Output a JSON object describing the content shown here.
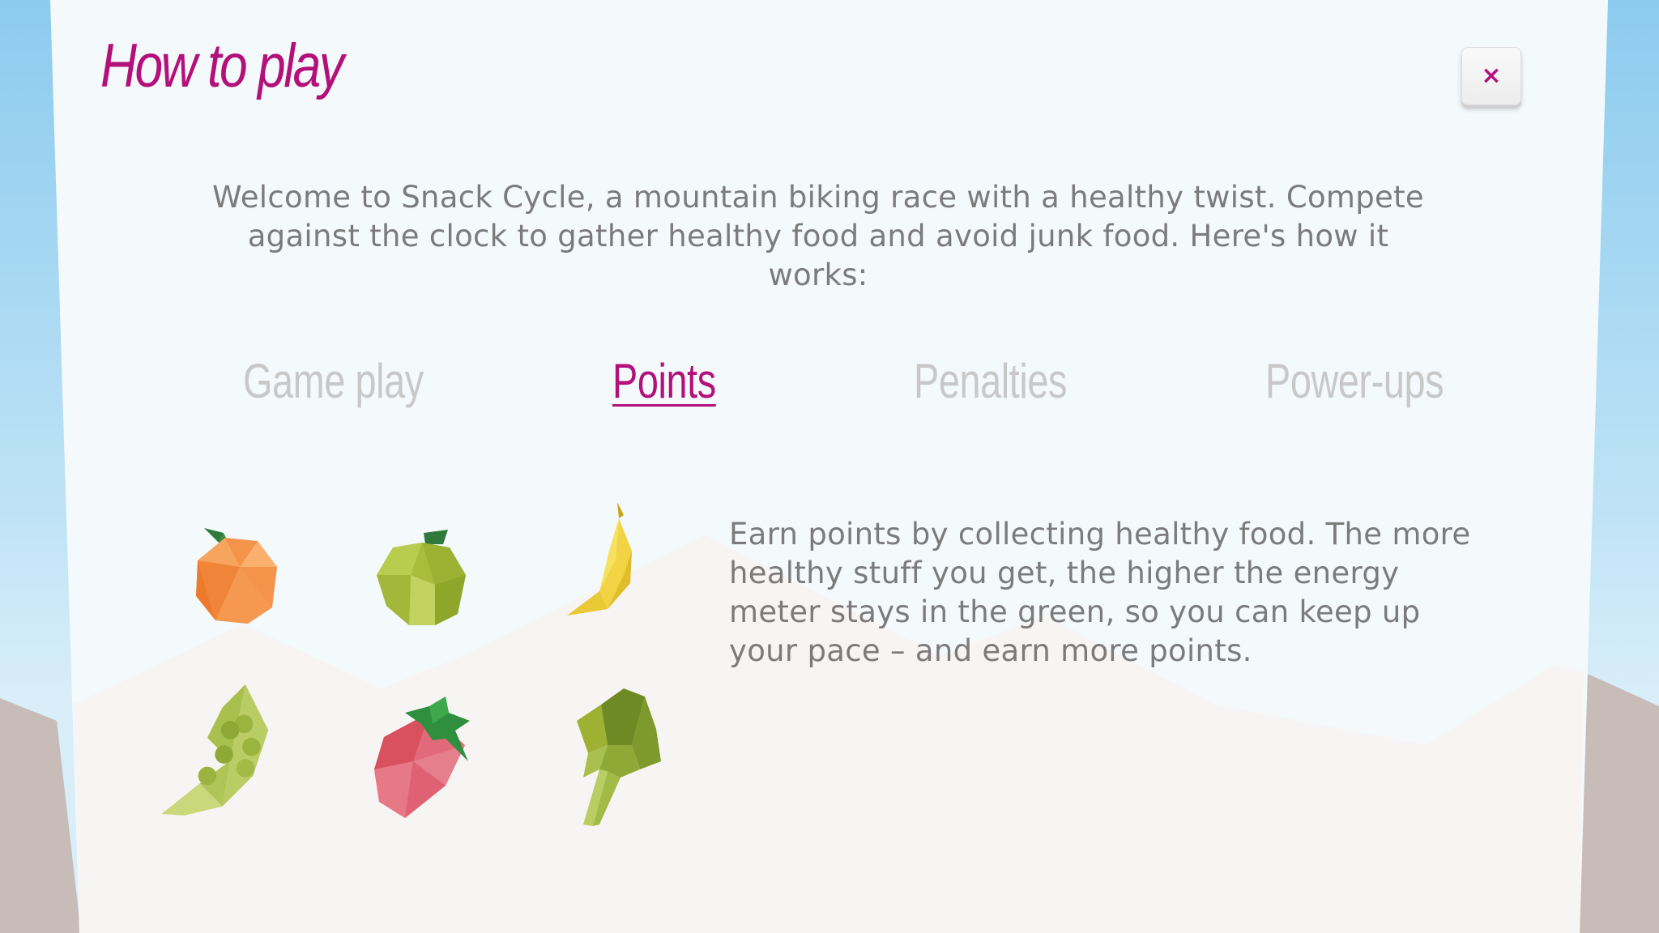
{
  "dialog": {
    "title": "How to play",
    "close_label": "×",
    "intro": "Welcome to Snack Cycle, a mountain biking race with a healthy twist. Compete against the clock to gather healthy food and avoid junk food. Here's how it works:"
  },
  "tabs": [
    {
      "label": "Game play",
      "active": false
    },
    {
      "label": "Points",
      "active": true
    },
    {
      "label": "Penalties",
      "active": false
    },
    {
      "label": "Power-ups",
      "active": false
    }
  ],
  "points": {
    "description": "Earn points by collecting healthy food. The more healthy stuff you get, the higher the energy meter stays in the green, so you can keep up your pace – and earn more points.",
    "foods": [
      "orange-icon",
      "apple-icon",
      "banana-icon",
      "peas-icon",
      "strawberry-icon",
      "spinach-icon"
    ]
  },
  "colors": {
    "accent": "#b3107a",
    "text": "#7b7b7b",
    "tab_inactive": "#c8c8c8",
    "panel": "#f4f9fc",
    "sky": "#8ccbee"
  }
}
